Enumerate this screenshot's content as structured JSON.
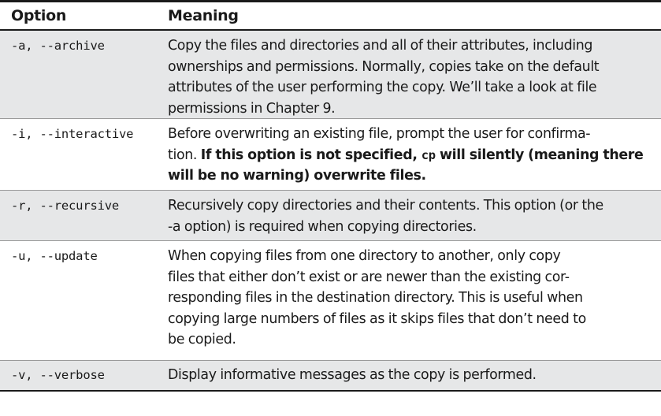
{
  "header": {
    "option": "Option",
    "meaning": "Meaning"
  },
  "rows": [
    {
      "option": "-a, --archive",
      "lines": [
        "Copy the files and directories and all of their attributes, including",
        "ownerships and permissions. Normally, copies take on the default",
        "attributes of the user performing the copy. We’ll take a look at file",
        "permissions in Chapter 9."
      ]
    },
    {
      "option": "-i, --interactive",
      "line1": "Before overwriting an existing file, prompt the user for confirma-",
      "line2_normal": "tion. ",
      "line2_bold_a": "If this option is not specified, ",
      "line2_code": "cp",
      "line2_bold_b": " will silently (meaning there",
      "line3_bold": "will be no warning) overwrite files."
    },
    {
      "option": "-r, --recursive",
      "lines": [
        "Recursively copy directories and their contents. This option (or the",
        "-a option) is required when copying directories."
      ]
    },
    {
      "option": "-u, --update",
      "lines": [
        "When copying files from one directory to another, only copy",
        "files that either don’t exist or are newer than the existing cor-",
        "responding files in the destination directory. This is useful when",
        "copying large numbers of files as it skips files that don’t need to",
        "be copied."
      ]
    },
    {
      "option": "-v, --verbose",
      "lines": [
        "Display informative messages as the copy is performed."
      ]
    }
  ]
}
